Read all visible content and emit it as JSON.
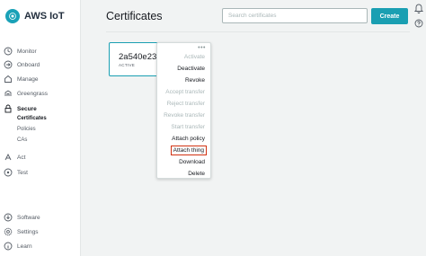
{
  "app": {
    "name": "AWS IoT"
  },
  "nav": {
    "monitor": "Monitor",
    "onboard": "Onboard",
    "manage": "Manage",
    "greengrass": "Greengrass",
    "secure": "Secure",
    "secure_children": [
      "Certificates",
      "Policies",
      "CAs"
    ],
    "act": "Act",
    "test": "Test",
    "software": "Software",
    "settings": "Settings",
    "learn": "Learn"
  },
  "header": {
    "title": "Certificates",
    "search_placeholder": "Search certificates",
    "create_label": "Create"
  },
  "card": {
    "id": "2a540e234",
    "status": "ACTIVE"
  },
  "menu": {
    "dots": "•••",
    "items": [
      {
        "label": "Activate",
        "disabled": true
      },
      {
        "label": "Deactivate",
        "disabled": false
      },
      {
        "label": "Revoke",
        "disabled": false
      },
      {
        "label": "Accept transfer",
        "disabled": true
      },
      {
        "label": "Reject transfer",
        "disabled": true
      },
      {
        "label": "Revoke transfer",
        "disabled": true
      },
      {
        "label": "Start transfer",
        "disabled": true
      },
      {
        "label": "Attach policy",
        "disabled": false
      },
      {
        "label": "Attach thing",
        "disabled": false,
        "highlighted": true
      },
      {
        "label": "Download",
        "disabled": false
      },
      {
        "label": "Delete",
        "disabled": false
      }
    ]
  },
  "colors": {
    "accent": "#1a9fb2",
    "highlight": "#d13212"
  }
}
